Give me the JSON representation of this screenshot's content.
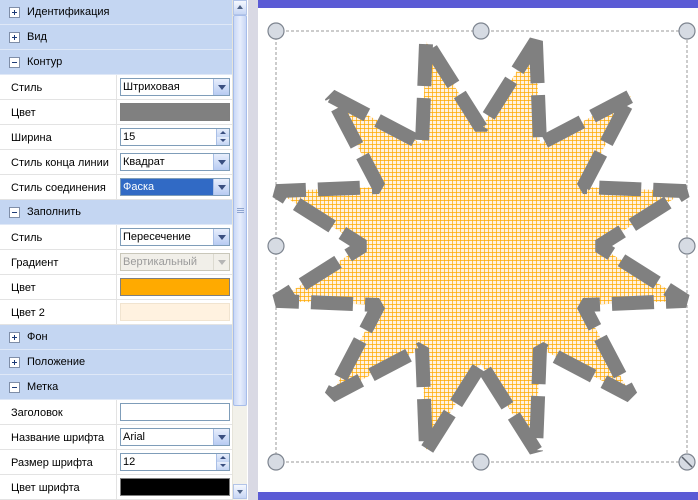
{
  "properties_panel": {
    "sections": [
      {
        "title": "Идентификация",
        "expanded": false
      },
      {
        "title": "Вид",
        "expanded": false
      },
      {
        "title": "Контур",
        "expanded": true
      },
      {
        "title": "Заполнить",
        "expanded": true
      },
      {
        "title": "Фон",
        "expanded": false
      },
      {
        "title": "Положение",
        "expanded": false
      },
      {
        "title": "Метка",
        "expanded": true
      }
    ],
    "contour": {
      "style_label": "Стиль",
      "style_value": "Штриховая",
      "color_label": "Цвет",
      "color_value": "#808080",
      "width_label": "Ширина",
      "width_value": "15",
      "line_cap_label": "Стиль конца линии",
      "line_cap_value": "Квадрат",
      "join_label": "Стиль соединения",
      "join_value": "Фаска"
    },
    "fill": {
      "style_label": "Стиль",
      "style_value": "Пересечение",
      "gradient_label": "Градиент",
      "gradient_value": "Вертикальный",
      "color_label": "Цвет",
      "color_value": "#ffaa00",
      "color2_label": "Цвет 2",
      "color2_value": "#fff2e0"
    },
    "label": {
      "caption_label": "Заголовок",
      "caption_value": "",
      "font_name_label": "Название шрифта",
      "font_name_value": "Arial",
      "font_size_label": "Размер шрифта",
      "font_size_value": "12",
      "font_color_label": "Цвет шрифта",
      "font_color_value": "#000000"
    }
  },
  "canvas": {
    "shape": "star",
    "star_points": 12,
    "outline_color": "#808080",
    "fill_color": "#ffaa00",
    "background_fill": "#fff2e0",
    "selection_handle_icon": "circle-handle-icon",
    "rotate_handle_icon": "rotate-handle-icon",
    "band_color": "#5b5bd5"
  }
}
